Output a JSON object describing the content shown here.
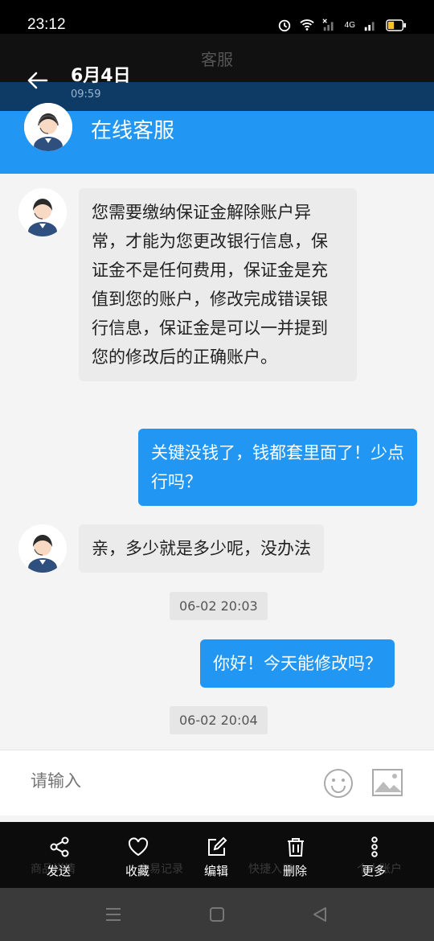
{
  "status_bar": {
    "time": "23:12",
    "signal_label": "4G"
  },
  "app_header": {
    "title": "客服"
  },
  "overlay": {
    "date": "6月4日",
    "time": "09:59"
  },
  "service_header": {
    "title": "在线客服"
  },
  "messages": [
    {
      "side": "left",
      "text": "您需要缴纳保证金解除账户异常，才能为您更改银行信息，保证金不是任何费用，保证金是充值到您的账户，修改完成错误银行信息，保证金是可以一并提到您的修改后的正确账户。"
    },
    {
      "side": "right",
      "text": "关键没钱了，钱都套里面了！少点行吗？"
    },
    {
      "side": "left",
      "text": "亲，多少就是多少呢，没办法"
    },
    {
      "side": "time",
      "text": "06-02 20:03"
    },
    {
      "side": "right",
      "text": "你好！今天能修改吗？"
    },
    {
      "side": "time",
      "text": "06-02 20:04"
    }
  ],
  "input": {
    "placeholder": "请输入"
  },
  "background_nav": {
    "items": [
      "商品详情",
      "交易记录",
      "快捷入口",
      "个人账户"
    ]
  },
  "actions": [
    {
      "label": "发送",
      "icon": "share-icon"
    },
    {
      "label": "收藏",
      "icon": "heart-icon"
    },
    {
      "label": "编辑",
      "icon": "edit-icon"
    },
    {
      "label": "删除",
      "icon": "trash-icon"
    },
    {
      "label": "更多",
      "icon": "more-icon"
    }
  ],
  "colors": {
    "accent": "#2196f3",
    "bubble_left": "#ebebeb",
    "bubble_right": "#2196f3"
  }
}
